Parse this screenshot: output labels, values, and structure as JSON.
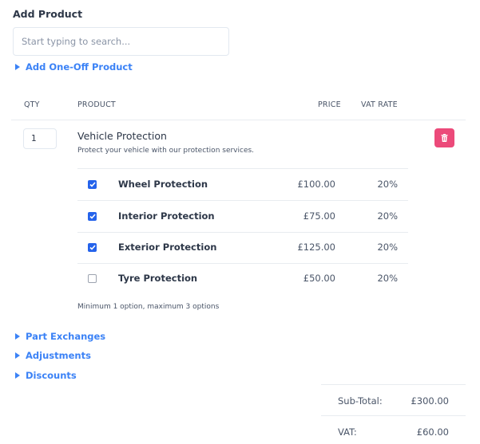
{
  "add_product": {
    "title": "Add Product",
    "search_placeholder": "Start typing to search...",
    "search_value": "",
    "one_off_label": "Add One-Off Product"
  },
  "table": {
    "headers": {
      "qty": "QTY",
      "product": "PRODUCT",
      "price": "PRICE",
      "vat_rate": "VAT RATE"
    }
  },
  "line_item": {
    "qty": "1",
    "name": "Vehicle Protection",
    "description": "Protect your vehicle with our protection services.",
    "delete_icon": "trash-icon",
    "options": [
      {
        "name": "Wheel Protection",
        "price": "£100.00",
        "vat": "20%",
        "checked": true
      },
      {
        "name": "Interior Protection",
        "price": "£75.00",
        "vat": "20%",
        "checked": true
      },
      {
        "name": "Exterior Protection",
        "price": "£125.00",
        "vat": "20%",
        "checked": true
      },
      {
        "name": "Tyre Protection",
        "price": "£50.00",
        "vat": "20%",
        "checked": false
      }
    ],
    "hint": "Minimum 1 option, maximum 3 options"
  },
  "sections": [
    {
      "label": "Part Exchanges"
    },
    {
      "label": "Adjustments"
    },
    {
      "label": "Discounts"
    }
  ],
  "summary": {
    "subtotal_label": "Sub-Total:",
    "subtotal_value": "£300.00",
    "vat_label": "VAT:",
    "vat_value": "£60.00"
  },
  "colors": {
    "link": "#3b82f6",
    "delete": "#ec4a7a",
    "checkbox": "#2563eb"
  }
}
